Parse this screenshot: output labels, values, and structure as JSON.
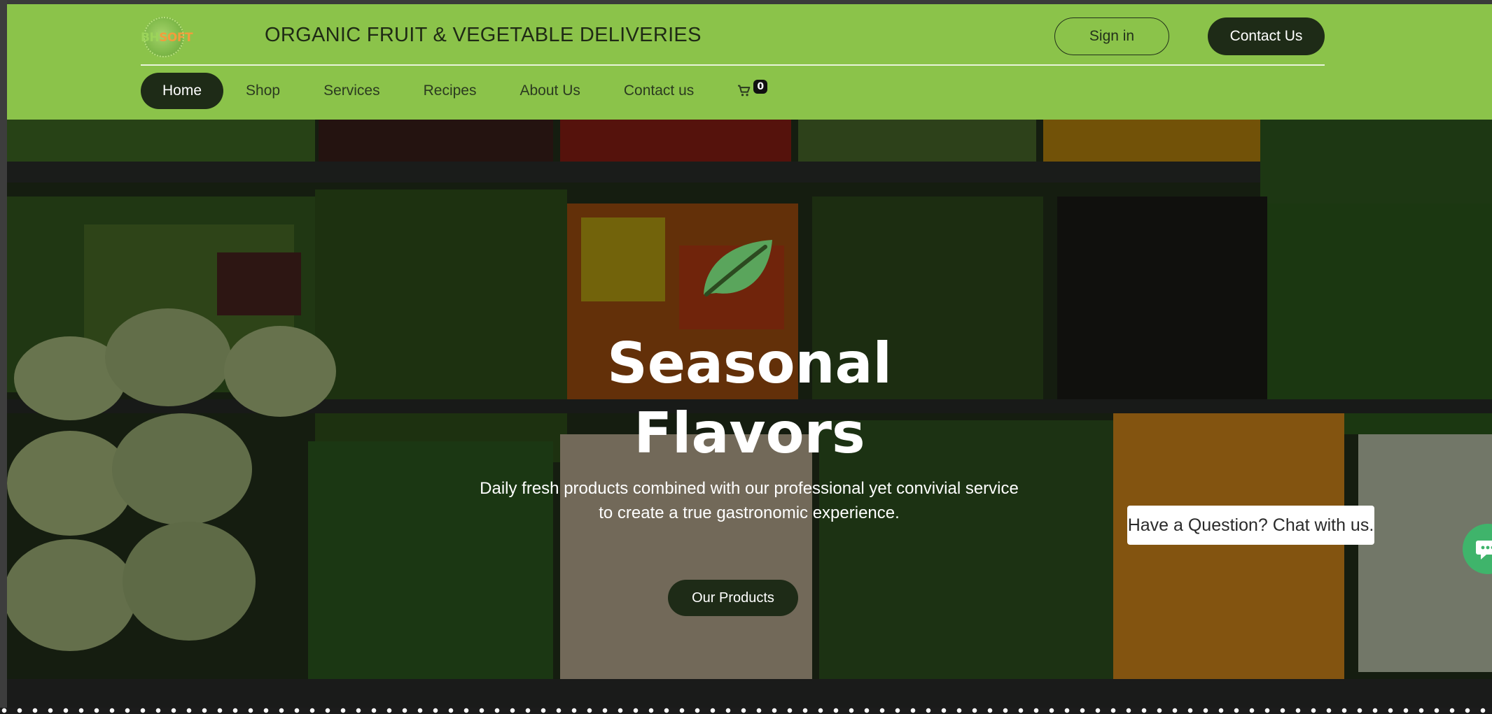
{
  "header": {
    "logo": {
      "part1": "BH",
      "part2": "SOFT"
    },
    "site_title": "ORGANIC FRUIT & VEGETABLE DELIVERIES",
    "signin_label": "Sign in",
    "contact_label": "Contact Us"
  },
  "nav": {
    "items": [
      {
        "label": "Home",
        "active": true
      },
      {
        "label": "Shop"
      },
      {
        "label": "Services"
      },
      {
        "label": "Recipes"
      },
      {
        "label": "About Us"
      },
      {
        "label": "Contact us"
      }
    ],
    "cart_icon": "shopping-cart-icon",
    "cart_count": "0"
  },
  "hero": {
    "icon": "leaf-icon",
    "title_line1": "Seasonal",
    "title_line2": "Flavors",
    "subtitle_line1": "Daily fresh products combined with our professional yet convivial service",
    "subtitle_line2": "to create a true gastronomic experience.",
    "cta_label": "Our Products"
  },
  "chat": {
    "prompt": "Have a Question? Chat with us.",
    "icon": "chat-bubble-icon"
  },
  "colors": {
    "header_bg": "#8bc34a",
    "dark_green": "#1e2b17",
    "leaf_green": "#5aa55c",
    "chat_green": "#3fb46b"
  }
}
